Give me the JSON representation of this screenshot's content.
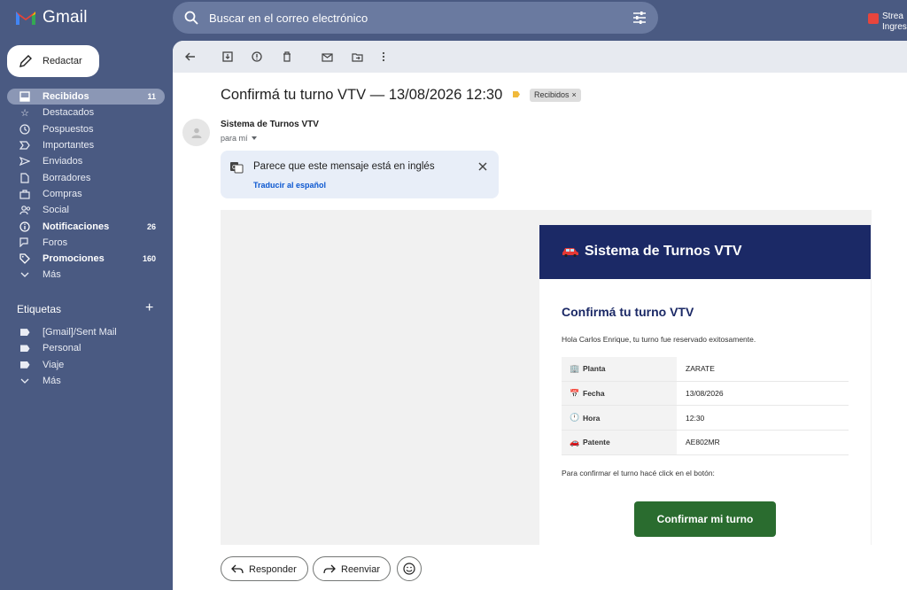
{
  "app": {
    "name": "Gmail"
  },
  "search": {
    "placeholder": "Buscar en el correo electrónico"
  },
  "topright": {
    "line1": "Strea",
    "line2": "Ingres"
  },
  "compose": {
    "label": "Redactar"
  },
  "sidebar": {
    "items": [
      {
        "label": "Recibidos",
        "count": "11",
        "icon": "inbox-icon"
      },
      {
        "label": "Destacados",
        "count": "",
        "icon": "star-icon"
      },
      {
        "label": "Pospuestos",
        "count": "",
        "icon": "clock-icon"
      },
      {
        "label": "Importantes",
        "count": "",
        "icon": "important-icon"
      },
      {
        "label": "Enviados",
        "count": "",
        "icon": "send-icon"
      },
      {
        "label": "Borradores",
        "count": "",
        "icon": "draft-icon"
      },
      {
        "label": "Compras",
        "count": "",
        "icon": "shopping-icon"
      },
      {
        "label": "Social",
        "count": "",
        "icon": "people-icon"
      },
      {
        "label": "Notificaciones",
        "count": "26",
        "icon": "info-icon"
      },
      {
        "label": "Foros",
        "count": "",
        "icon": "forum-icon"
      },
      {
        "label": "Promociones",
        "count": "160",
        "icon": "tag-icon"
      },
      {
        "label": "Más",
        "count": "",
        "icon": "chevron-down-icon"
      }
    ],
    "labels_title": "Etiquetas",
    "labels": [
      {
        "label": "[Gmail]/Sent Mail"
      },
      {
        "label": "Personal"
      },
      {
        "label": "Viaje"
      },
      {
        "label": "Más"
      }
    ]
  },
  "message": {
    "subject": "Confirmá tu turno VTV — 13/08/2026 12:30",
    "chip": "Recibidos",
    "sender": "Sistema de Turnos VTV",
    "to": "para mí",
    "translate_msg": "Parece que este mensaje está en inglés",
    "translate_link": "Traducir al español"
  },
  "email": {
    "header": "Sistema de Turnos VTV",
    "h2": "Confirmá tu turno VTV",
    "greeting": "Hola Carlos Enrique, tu turno fue reservado exitosamente.",
    "rows": [
      {
        "emoji": "🏢",
        "key": "Planta",
        "value": "ZARATE"
      },
      {
        "emoji": "📅",
        "key": "Fecha",
        "value": "13/08/2026"
      },
      {
        "emoji": "🕛",
        "key": "Hora",
        "value": "12:30"
      },
      {
        "emoji": "🚗",
        "key": "Patente",
        "value": "AE802MR"
      }
    ],
    "confirm_text": "Para confirmar el turno hacé click en el botón:",
    "confirm_button": "Confirmar mi turno"
  },
  "footer": {
    "reply": "Responder",
    "forward": "Reenviar"
  },
  "colors": {
    "sidebar_bg": "#4a5a82",
    "email_header": "#1b2966",
    "confirm_button": "#2a6c2f",
    "link": "#0b57d0"
  }
}
